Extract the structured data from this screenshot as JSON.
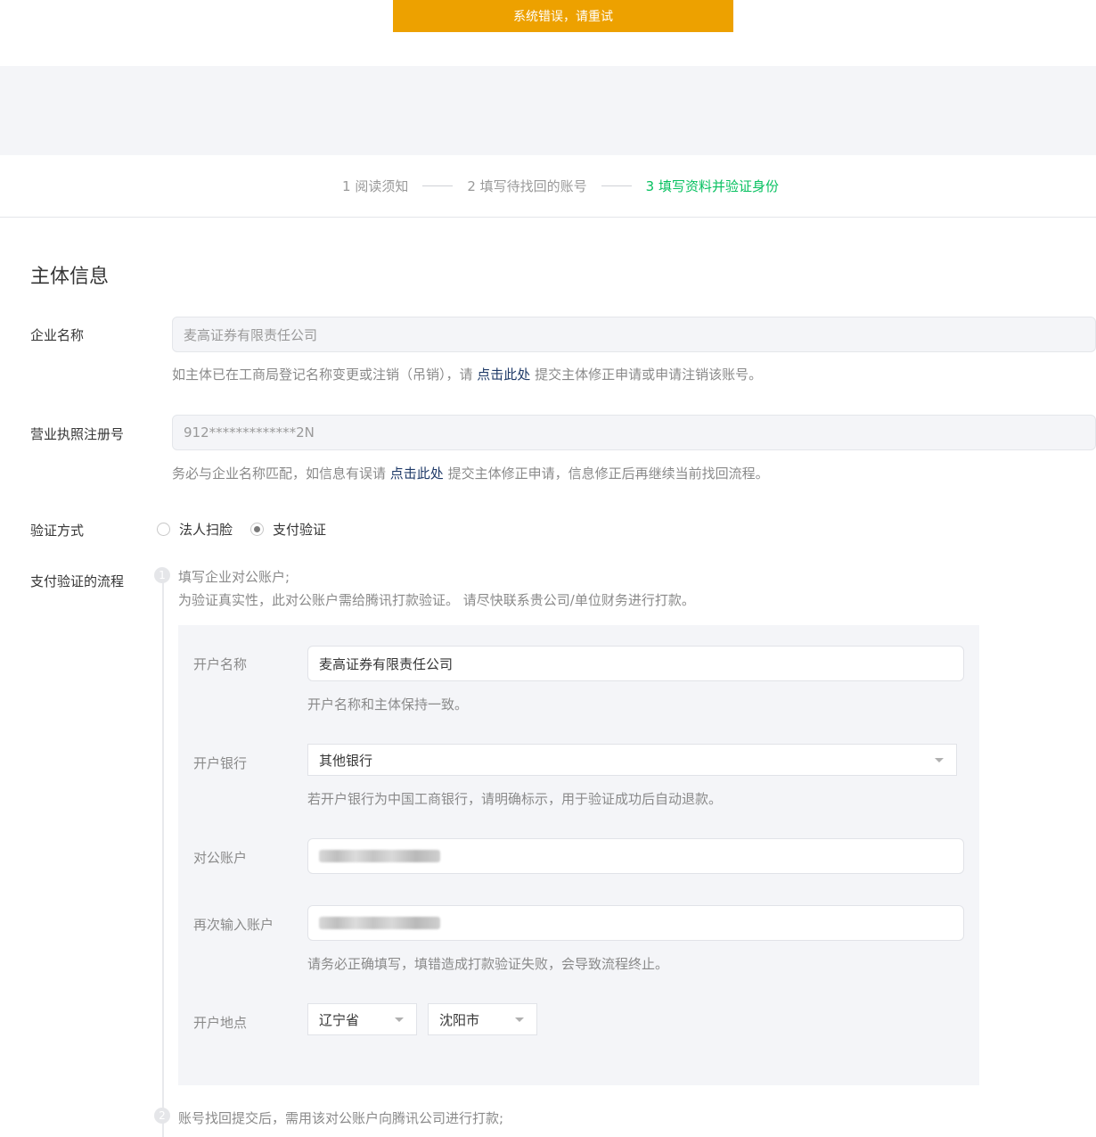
{
  "toast": {
    "message": "系统错误，请重试"
  },
  "steps": [
    {
      "label": "1 阅读须知",
      "active": false
    },
    {
      "label": "2 填写待找回的账号",
      "active": false
    },
    {
      "label": "3 填写资料并验证身份",
      "active": true
    }
  ],
  "section": {
    "title": "主体信息"
  },
  "company": {
    "label": "企业名称",
    "value": "麦高证券有限责任公司",
    "hint_before": "如主体已在工商局登记名称变更或注销（吊销），请 ",
    "hint_link": "点击此处",
    "hint_after": " 提交主体修正申请或申请注销该账号。"
  },
  "license": {
    "label": "营业执照注册号",
    "value": "912*************2N",
    "hint_before": "务必与企业名称匹配，如信息有误请 ",
    "hint_link": "点击此处",
    "hint_after": " 提交主体修正申请，信息修正后再继续当前找回流程。"
  },
  "verify": {
    "label": "验证方式",
    "options": [
      {
        "label": "法人扫脸",
        "checked": false
      },
      {
        "label": "支付验证",
        "checked": true
      }
    ]
  },
  "flow": {
    "label": "支付验证的流程",
    "step1_num": "1",
    "step1_title": "填写企业对公账户;",
    "step1_desc": "为验证真实性，此对公账户需给腾讯打款验证。 请尽快联系贵公司/单位财务进行打款。",
    "step2_num": "2",
    "step2_text": "账号找回提交后，需用该对公账户向腾讯公司进行打款;"
  },
  "panel": {
    "account_name": {
      "label": "开户名称",
      "value": "麦高证券有限责任公司",
      "hint": "开户名称和主体保持一致。"
    },
    "bank": {
      "label": "开户银行",
      "value": "其他银行",
      "hint": "若开户银行为中国工商银行，请明确标示，用于验证成功后自动退款。"
    },
    "account": {
      "label": "对公账户"
    },
    "account_repeat": {
      "label": "再次输入账户",
      "hint": "请务必正确填写，填错造成打款验证失败，会导致流程终止。"
    },
    "location": {
      "label": "开户地点",
      "province": "辽宁省",
      "city": "沈阳市"
    }
  }
}
